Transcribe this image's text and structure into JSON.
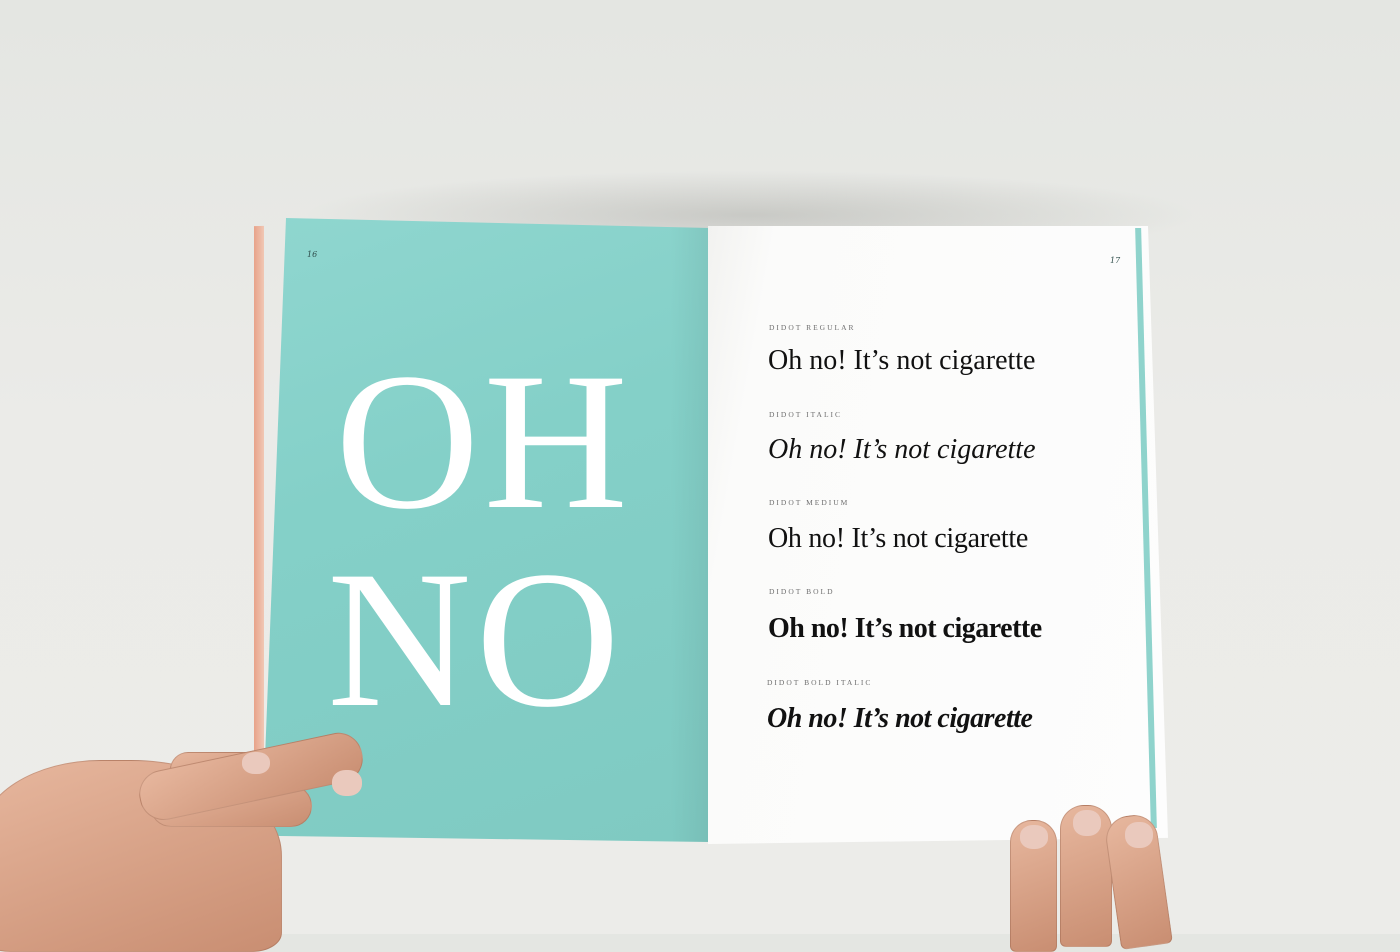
{
  "scene": {
    "description_free": true
  },
  "left_page": {
    "page_number": "16",
    "big_text_line1": "OH",
    "big_text_line2": "NO",
    "background_color": "#86d1c9"
  },
  "right_page": {
    "page_number": "17",
    "specimens": [
      {
        "label": "DIDOT REGULAR",
        "sample": "Oh no! It’s not cigarette"
      },
      {
        "label": "DIDOT ITALIC",
        "sample": "Oh no! It’s not cigarette"
      },
      {
        "label": "DIDOT MEDIUM",
        "sample": "Oh no! It’s not cigarette"
      },
      {
        "label": "DIDOT BOLD",
        "sample": "Oh no! It’s not cigarette"
      },
      {
        "label": "DIDOT BOLD ITALIC",
        "sample": "Oh no! It’s not cigarette"
      }
    ]
  }
}
